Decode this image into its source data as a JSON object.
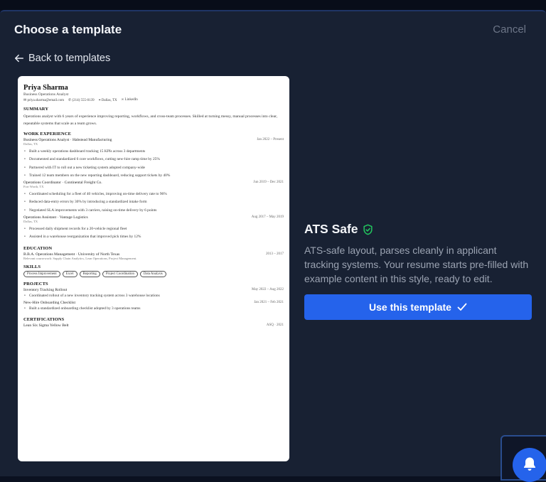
{
  "modal": {
    "title": "Choose a template",
    "cancel_label": "Cancel",
    "back_label": "Back to templates"
  },
  "template": {
    "name": "ATS Safe",
    "description": "ATS-safe layout, parses cleanly in applicant tracking systems. Your resume starts pre-filled with example content in this style, ready to edit.",
    "use_label": "Use this template",
    "accent_color": "#2563eb",
    "shield_color": "#22c55e"
  },
  "resume": {
    "name": "Priya Sharma",
    "role": "Business Operations Analyst",
    "contact": {
      "email": "priya.sharma@email.com",
      "phone": "(214) 555-0139",
      "location": "Dallas, TX",
      "link": "LinkedIn"
    },
    "summary_heading": "SUMMARY",
    "summary": "Operations analyst with 6 years of experience improving reporting, workflows, and cross-team processes. Skilled at turning messy, manual processes into clear, repeatable systems that scale as a team grows.",
    "experience_heading": "WORK EXPERIENCE",
    "jobs": [
      {
        "title": "Business Operations Analyst · Habstead Manufacturing",
        "dates": "Jan 2022 – Present",
        "location": "Dallas, TX",
        "bullets": [
          "Built a weekly operations dashboard tracking 15 KPIs across 3 departments",
          "Documented and standardized 6 core workflows, cutting new-hire ramp time by 25%",
          "Partnered with IT to roll out a new ticketing system adopted company-wide",
          "Trained 12 team members on the new reporting dashboard, reducing support tickets by 40%"
        ]
      },
      {
        "title": "Operations Coordinator · Continental Freight Co.",
        "dates": "Jun 2019 – Dec 2021",
        "location": "Fort Worth, TX",
        "bullets": [
          "Coordinated scheduling for a fleet of 40 vehicles, improving on-time delivery rate to 96%",
          "Reduced data-entry errors by 30% by introducing a standardized intake form",
          "Negotiated SLA improvements with 3 carriers, raising on-time delivery by 6 points"
        ]
      },
      {
        "title": "Operations Assistant · Vantage Logistics",
        "dates": "Aug 2017 – May 2019",
        "location": "Dallas, TX",
        "bullets": [
          "Processed daily shipment records for a 20-vehicle regional fleet",
          "Assisted in a warehouse reorganization that improved pick times by 12%"
        ]
      }
    ],
    "education_heading": "EDUCATION",
    "education": {
      "degree": "B.B.A. Operations Management · University of North Texas",
      "dates": "2013 – 2017",
      "coursework": "Relevant coursework: Supply Chain Analytics, Lean Operations, Project Management."
    },
    "skills_heading": "SKILLS",
    "skills": [
      "Process Improvement",
      "Excel",
      "Reporting",
      "Project Coordination",
      "Data Analysis"
    ],
    "projects_heading": "PROJECTS",
    "projects": [
      {
        "title": "Inventory Tracking Rollout",
        "dates": "May 2022 – Aug 2022",
        "bullet": "Coordinated rollout of a new inventory tracking system across 3 warehouse locations"
      },
      {
        "title": "New-Hire Onboarding Checklist",
        "dates": "Jan 2021 – Feb 2021",
        "bullet": "Built a standardized onboarding checklist adopted by 3 operations teams"
      }
    ],
    "certifications_heading": "CERTIFICATIONS",
    "certification": {
      "name": "Lean Six Sigma Yellow Belt",
      "issuer": "ASQ · 2021"
    }
  }
}
